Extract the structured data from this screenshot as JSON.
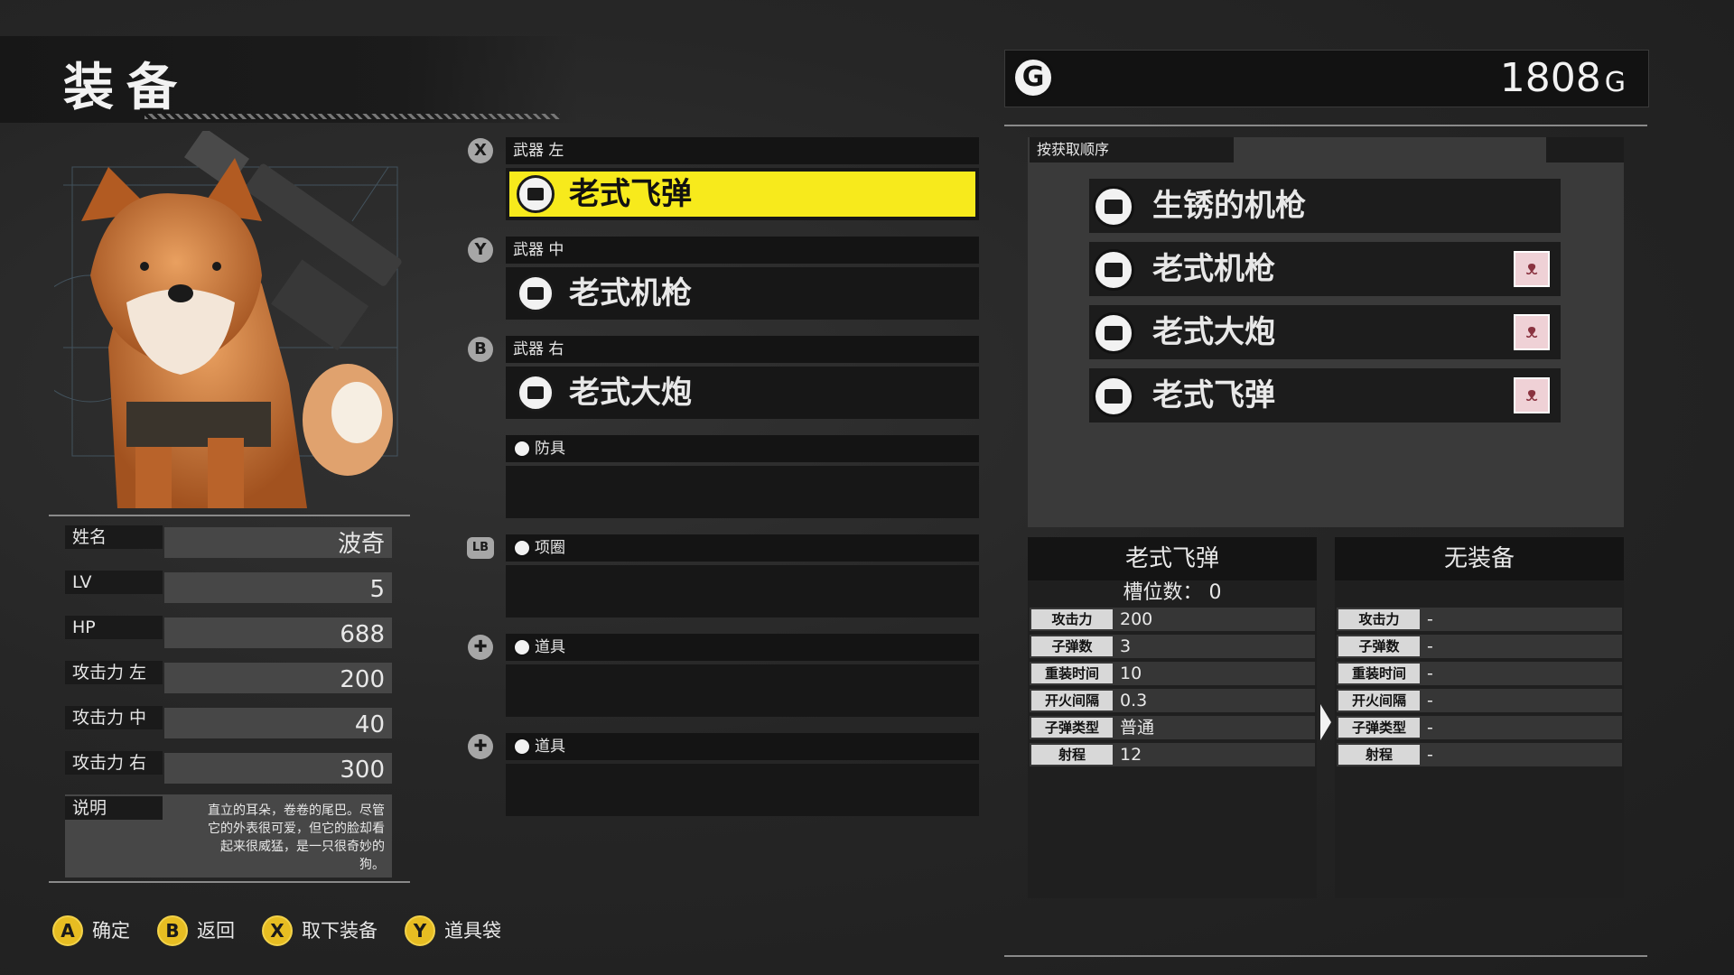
{
  "header": {
    "title": "装备"
  },
  "gold": {
    "icon": "G",
    "value": "1808",
    "unit": "G"
  },
  "character": {
    "stats": [
      {
        "label": "姓名",
        "value": "波奇"
      },
      {
        "label": "LV",
        "value": "5"
      },
      {
        "label": "HP",
        "value": "688"
      },
      {
        "label": "攻击力 左",
        "value": "200"
      },
      {
        "label": "攻击力 中",
        "value": "40"
      },
      {
        "label": "攻击力 右",
        "value": "300"
      }
    ],
    "description_label": "说明",
    "description": "直立的耳朵，卷卷的尾巴。尽管它的外表很可爱，但它的脸却看起来很威猛，是一只很奇妙的狗。"
  },
  "slots": [
    {
      "button": "X",
      "label": "武器 左",
      "item": "老式飞弹",
      "selected": true
    },
    {
      "button": "Y",
      "label": "武器 中",
      "item": "老式机枪"
    },
    {
      "button": "B",
      "label": "武器 右",
      "item": "老式大炮"
    },
    {
      "label": "防具",
      "item": ""
    },
    {
      "button": "LB",
      "label": "项圈",
      "item": ""
    },
    {
      "label": "道具",
      "item": ""
    },
    {
      "label": "道具",
      "item": ""
    }
  ],
  "inventory": {
    "sort_label": "按获取顺序",
    "items": [
      {
        "name": "生锈的机枪",
        "equipped_by_dog": false
      },
      {
        "name": "老式机枪",
        "equipped_by_dog": true
      },
      {
        "name": "老式大炮",
        "equipped_by_dog": true
      },
      {
        "name": "老式飞弹",
        "equipped_by_dog": true
      }
    ]
  },
  "compare": {
    "left": {
      "title": "老式飞弹",
      "sub": "槽位数： 0",
      "rows": [
        {
          "k": "攻击力",
          "v": "200"
        },
        {
          "k": "子弹数",
          "v": "3"
        },
        {
          "k": "重装时间",
          "v": "10"
        },
        {
          "k": "开火间隔",
          "v": "0.3"
        },
        {
          "k": "子弹类型",
          "v": "普通"
        },
        {
          "k": "射程",
          "v": "12"
        }
      ]
    },
    "right": {
      "title": "无装备",
      "rows": [
        {
          "k": "攻击力",
          "v": "-"
        },
        {
          "k": "子弹数",
          "v": "-"
        },
        {
          "k": "重装时间",
          "v": "-"
        },
        {
          "k": "开火间隔",
          "v": "-"
        },
        {
          "k": "子弹类型",
          "v": "-"
        },
        {
          "k": "射程",
          "v": "-"
        }
      ]
    }
  },
  "footer": [
    {
      "button": "A",
      "label": "确定"
    },
    {
      "button": "B",
      "label": "返回"
    },
    {
      "button": "X",
      "label": "取下装备"
    },
    {
      "button": "Y",
      "label": "道具袋"
    }
  ],
  "colors": {
    "highlight": "#f7ea1c",
    "footer_button": "#e7bd22",
    "tag_bg": "#efd1d6"
  }
}
